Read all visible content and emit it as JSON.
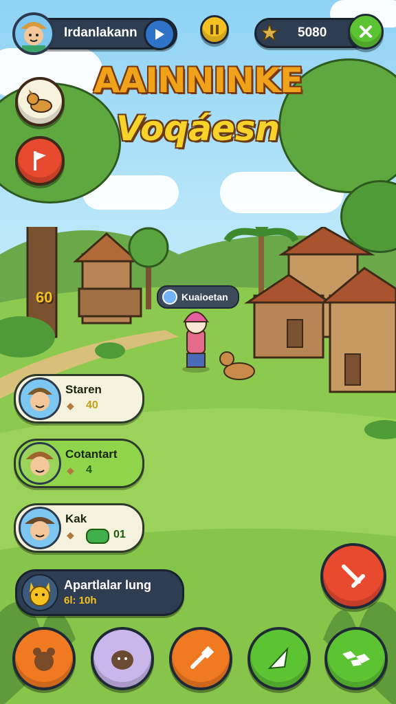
{
  "player": {
    "name": "Irdanlakann"
  },
  "currency": {
    "amount": "5080"
  },
  "title": {
    "line1": "AAINNINKE",
    "line2": "Voqáesn"
  },
  "tree_label": "60",
  "npc_label": "Kuaioetan",
  "characters": [
    {
      "name": "Staren",
      "value": "40"
    },
    {
      "name": "Cotantart",
      "value": "4"
    },
    {
      "name": "Kak",
      "value": "01"
    }
  ],
  "quest": {
    "title": "Apartlalar lung",
    "sub": "6l: 10h"
  },
  "icons": {
    "play": "play-icon",
    "pause": "pause-icon",
    "star": "star-icon",
    "close": "close-icon",
    "pet": "dog-icon",
    "flag": "flag-icon"
  },
  "colors": {
    "red_btn": "#e84a2f",
    "orange_btn": "#f07a22",
    "lavender_btn": "#c9b6ea",
    "green_btn": "#5cc332",
    "gold": "#f6c222"
  }
}
